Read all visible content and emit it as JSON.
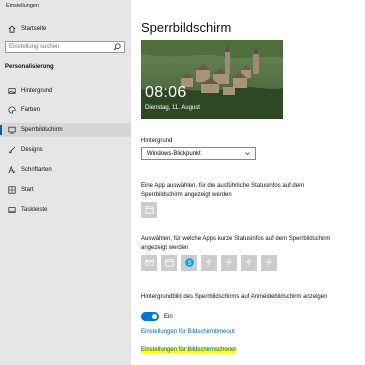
{
  "window": {
    "title": "Einstellungen"
  },
  "sidebar": {
    "home_label": "Startseite",
    "search_placeholder": "Einstellung suchen",
    "section_title": "Personalisierung",
    "items": [
      {
        "label": "Hintergrund",
        "icon": "picture-icon"
      },
      {
        "label": "Farben",
        "icon": "palette-icon"
      },
      {
        "label": "Sperrbildschirm",
        "icon": "lockscreen-icon",
        "active": true
      },
      {
        "label": "Designs",
        "icon": "brush-icon"
      },
      {
        "label": "Schriftarten",
        "icon": "font-icon"
      },
      {
        "label": "Start",
        "icon": "start-icon"
      },
      {
        "label": "Taskleiste",
        "icon": "taskbar-icon"
      }
    ]
  },
  "main": {
    "title": "Sperrbildschirm",
    "preview": {
      "time": "08:06",
      "date": "Dienstag, 11. August"
    },
    "background_label": "Hintergrund",
    "background_value": "Windows-Blickpunkt",
    "detailed_status_label": "Eine App auswählen, für die ausführliche Statusinfos auf dem Sperrbildschirm angezeigt werden",
    "quick_status_label": "Auswählen, für welche Apps kurze Statusinfos auf dem Sperrbildschirm angezeigt werden",
    "signin_bg_label": "Hintergrundbild des Sperrbildschirms auf Anmeldebildschirm anzeigen",
    "toggle_state": "Ein",
    "link_timeout": "Einstellungen für Bildschirmtimeout",
    "link_screensaver": "Einstellungen für Bildschirmschoner"
  },
  "colors": {
    "accent": "#0078d7",
    "highlight": "#ffff00",
    "sidebar_bg": "#e6e6e6"
  }
}
